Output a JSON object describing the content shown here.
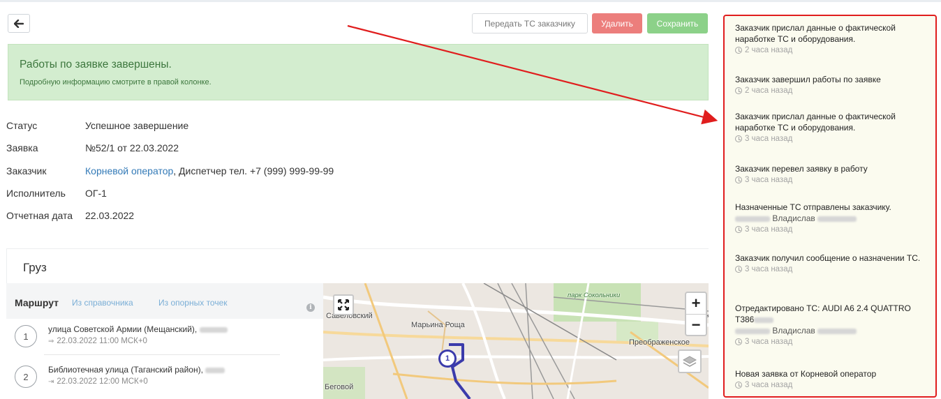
{
  "toolbar": {
    "transfer_label": "Передать ТС заказчику",
    "delete_label": "Удалить",
    "save_label": "Сохранить"
  },
  "alert": {
    "title": "Работы по заявке завершены.",
    "subtitle": "Подробную информацию смотрите в правой колонке."
  },
  "info": {
    "status_label": "Статус",
    "status_value": "Успешное завершение",
    "request_label": "Заявка",
    "request_value": "№52/1 от 22.03.2022",
    "customer_label": "Заказчик",
    "customer_link": "Корневой оператор",
    "customer_rest": ", Диспетчер тел. +7 (999) 999-99-99",
    "executor_label": "Исполнитель",
    "executor_value": "ОГ-1",
    "report_date_label": "Отчетная дата",
    "report_date_value": "22.03.2022"
  },
  "cargo": {
    "title": "Груз"
  },
  "route": {
    "title": "Маршрут",
    "tab_directory": "Из справочника",
    "tab_points": "Из опорных точек",
    "info_icon_glyph": "i",
    "stops": [
      {
        "num": "1",
        "address": "улица Советской Армии (Мещанский),",
        "time": "22.03.2022 11:00 МСК+0"
      },
      {
        "num": "2",
        "address": "Библиотечная улица (Таганский район),",
        "time": "22.03.2022 12:00 МСК+0"
      }
    ]
  },
  "map": {
    "labels": {
      "savelovsky": "Савеловский",
      "maryina": "Марьина Роща",
      "sokolniki": "парк Сокольники",
      "preobr": "Преображенское",
      "begovoy": "Беговой",
      "ok": "Ок"
    },
    "zoom_in": "+",
    "zoom_out": "−",
    "marker_num": "1"
  },
  "feed": {
    "items": [
      {
        "text": "Заказчик прислал данные о фактической наработке ТС и оборудования.",
        "person": "",
        "time": "2 часа назад"
      },
      {
        "text": "Заказчик завершил работы по заявке",
        "person": "",
        "time": "2 часа назад"
      },
      {
        "text": "Заказчик прислал данные о фактической наработке ТС и оборудования.",
        "person": "",
        "time": "3 часа назад"
      },
      {
        "text": "Заказчик перевел заявку в работу",
        "person": "",
        "time": "3 часа назад"
      },
      {
        "text": "Назначенные ТС отправлены заказчику.",
        "person": "Владислав",
        "time": "3 часа назад"
      },
      {
        "text": "Заказчик получил сообщение о назначении ТС.",
        "person": "",
        "time": "3 часа назад"
      },
      {
        "text": "Отредактировано ТС: AUDI A6 2.4 QUATTRO Т386",
        "person": "Владислав",
        "time": "3 часа назад"
      },
      {
        "text": "Новая заявка от Корневой оператор",
        "person": "",
        "time": "3 часа назад"
      }
    ]
  },
  "colors": {
    "delete": "#ec7e7c",
    "save": "#8cd189",
    "alert_bg": "#d3edcf",
    "feed_border": "#e01d1d",
    "link": "#337ab7"
  }
}
